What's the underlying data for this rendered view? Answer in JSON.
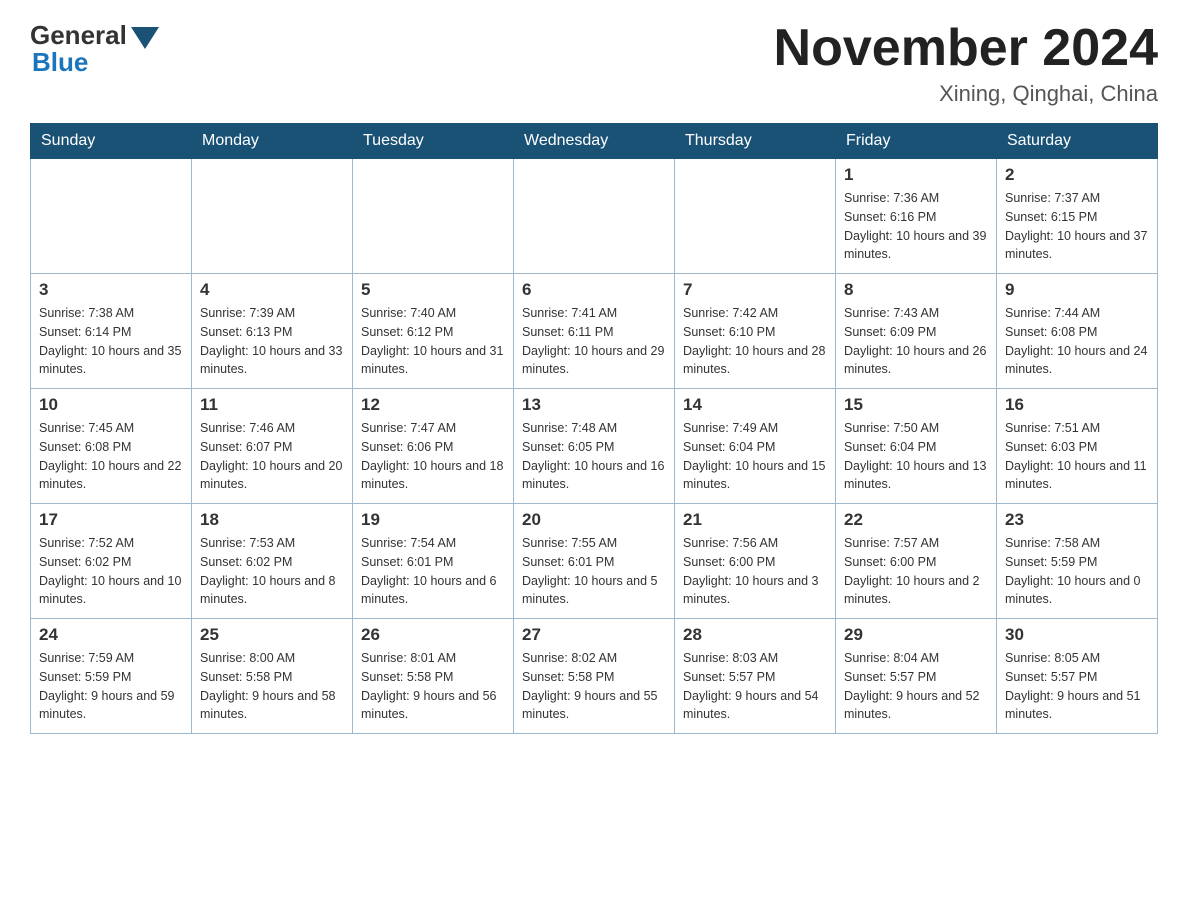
{
  "header": {
    "logo_general": "General",
    "logo_blue": "Blue",
    "title": "November 2024",
    "subtitle": "Xining, Qinghai, China"
  },
  "days_of_week": [
    "Sunday",
    "Monday",
    "Tuesday",
    "Wednesday",
    "Thursday",
    "Friday",
    "Saturday"
  ],
  "weeks": [
    [
      {
        "day": "",
        "sunrise": "",
        "sunset": "",
        "daylight": ""
      },
      {
        "day": "",
        "sunrise": "",
        "sunset": "",
        "daylight": ""
      },
      {
        "day": "",
        "sunrise": "",
        "sunset": "",
        "daylight": ""
      },
      {
        "day": "",
        "sunrise": "",
        "sunset": "",
        "daylight": ""
      },
      {
        "day": "",
        "sunrise": "",
        "sunset": "",
        "daylight": ""
      },
      {
        "day": "1",
        "sunrise": "Sunrise: 7:36 AM",
        "sunset": "Sunset: 6:16 PM",
        "daylight": "Daylight: 10 hours and 39 minutes."
      },
      {
        "day": "2",
        "sunrise": "Sunrise: 7:37 AM",
        "sunset": "Sunset: 6:15 PM",
        "daylight": "Daylight: 10 hours and 37 minutes."
      }
    ],
    [
      {
        "day": "3",
        "sunrise": "Sunrise: 7:38 AM",
        "sunset": "Sunset: 6:14 PM",
        "daylight": "Daylight: 10 hours and 35 minutes."
      },
      {
        "day": "4",
        "sunrise": "Sunrise: 7:39 AM",
        "sunset": "Sunset: 6:13 PM",
        "daylight": "Daylight: 10 hours and 33 minutes."
      },
      {
        "day": "5",
        "sunrise": "Sunrise: 7:40 AM",
        "sunset": "Sunset: 6:12 PM",
        "daylight": "Daylight: 10 hours and 31 minutes."
      },
      {
        "day": "6",
        "sunrise": "Sunrise: 7:41 AM",
        "sunset": "Sunset: 6:11 PM",
        "daylight": "Daylight: 10 hours and 29 minutes."
      },
      {
        "day": "7",
        "sunrise": "Sunrise: 7:42 AM",
        "sunset": "Sunset: 6:10 PM",
        "daylight": "Daylight: 10 hours and 28 minutes."
      },
      {
        "day": "8",
        "sunrise": "Sunrise: 7:43 AM",
        "sunset": "Sunset: 6:09 PM",
        "daylight": "Daylight: 10 hours and 26 minutes."
      },
      {
        "day": "9",
        "sunrise": "Sunrise: 7:44 AM",
        "sunset": "Sunset: 6:08 PM",
        "daylight": "Daylight: 10 hours and 24 minutes."
      }
    ],
    [
      {
        "day": "10",
        "sunrise": "Sunrise: 7:45 AM",
        "sunset": "Sunset: 6:08 PM",
        "daylight": "Daylight: 10 hours and 22 minutes."
      },
      {
        "day": "11",
        "sunrise": "Sunrise: 7:46 AM",
        "sunset": "Sunset: 6:07 PM",
        "daylight": "Daylight: 10 hours and 20 minutes."
      },
      {
        "day": "12",
        "sunrise": "Sunrise: 7:47 AM",
        "sunset": "Sunset: 6:06 PM",
        "daylight": "Daylight: 10 hours and 18 minutes."
      },
      {
        "day": "13",
        "sunrise": "Sunrise: 7:48 AM",
        "sunset": "Sunset: 6:05 PM",
        "daylight": "Daylight: 10 hours and 16 minutes."
      },
      {
        "day": "14",
        "sunrise": "Sunrise: 7:49 AM",
        "sunset": "Sunset: 6:04 PM",
        "daylight": "Daylight: 10 hours and 15 minutes."
      },
      {
        "day": "15",
        "sunrise": "Sunrise: 7:50 AM",
        "sunset": "Sunset: 6:04 PM",
        "daylight": "Daylight: 10 hours and 13 minutes."
      },
      {
        "day": "16",
        "sunrise": "Sunrise: 7:51 AM",
        "sunset": "Sunset: 6:03 PM",
        "daylight": "Daylight: 10 hours and 11 minutes."
      }
    ],
    [
      {
        "day": "17",
        "sunrise": "Sunrise: 7:52 AM",
        "sunset": "Sunset: 6:02 PM",
        "daylight": "Daylight: 10 hours and 10 minutes."
      },
      {
        "day": "18",
        "sunrise": "Sunrise: 7:53 AM",
        "sunset": "Sunset: 6:02 PM",
        "daylight": "Daylight: 10 hours and 8 minutes."
      },
      {
        "day": "19",
        "sunrise": "Sunrise: 7:54 AM",
        "sunset": "Sunset: 6:01 PM",
        "daylight": "Daylight: 10 hours and 6 minutes."
      },
      {
        "day": "20",
        "sunrise": "Sunrise: 7:55 AM",
        "sunset": "Sunset: 6:01 PM",
        "daylight": "Daylight: 10 hours and 5 minutes."
      },
      {
        "day": "21",
        "sunrise": "Sunrise: 7:56 AM",
        "sunset": "Sunset: 6:00 PM",
        "daylight": "Daylight: 10 hours and 3 minutes."
      },
      {
        "day": "22",
        "sunrise": "Sunrise: 7:57 AM",
        "sunset": "Sunset: 6:00 PM",
        "daylight": "Daylight: 10 hours and 2 minutes."
      },
      {
        "day": "23",
        "sunrise": "Sunrise: 7:58 AM",
        "sunset": "Sunset: 5:59 PM",
        "daylight": "Daylight: 10 hours and 0 minutes."
      }
    ],
    [
      {
        "day": "24",
        "sunrise": "Sunrise: 7:59 AM",
        "sunset": "Sunset: 5:59 PM",
        "daylight": "Daylight: 9 hours and 59 minutes."
      },
      {
        "day": "25",
        "sunrise": "Sunrise: 8:00 AM",
        "sunset": "Sunset: 5:58 PM",
        "daylight": "Daylight: 9 hours and 58 minutes."
      },
      {
        "day": "26",
        "sunrise": "Sunrise: 8:01 AM",
        "sunset": "Sunset: 5:58 PM",
        "daylight": "Daylight: 9 hours and 56 minutes."
      },
      {
        "day": "27",
        "sunrise": "Sunrise: 8:02 AM",
        "sunset": "Sunset: 5:58 PM",
        "daylight": "Daylight: 9 hours and 55 minutes."
      },
      {
        "day": "28",
        "sunrise": "Sunrise: 8:03 AM",
        "sunset": "Sunset: 5:57 PM",
        "daylight": "Daylight: 9 hours and 54 minutes."
      },
      {
        "day": "29",
        "sunrise": "Sunrise: 8:04 AM",
        "sunset": "Sunset: 5:57 PM",
        "daylight": "Daylight: 9 hours and 52 minutes."
      },
      {
        "day": "30",
        "sunrise": "Sunrise: 8:05 AM",
        "sunset": "Sunset: 5:57 PM",
        "daylight": "Daylight: 9 hours and 51 minutes."
      }
    ]
  ]
}
